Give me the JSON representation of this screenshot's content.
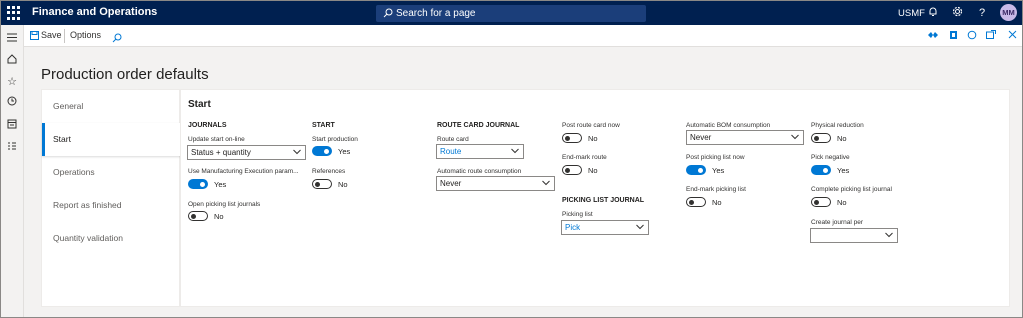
{
  "app": {
    "title": "Finance and Operations",
    "search_placeholder": "Search for a page",
    "company": "USMF",
    "avatar_initials": "MM"
  },
  "actions": {
    "save": "Save",
    "options": "Options"
  },
  "page_title": "Production order defaults",
  "tabs": [
    "General",
    "Start",
    "Operations",
    "Report as finished",
    "Quantity validation"
  ],
  "active_tab": "Start",
  "section_title": "Start",
  "journals": {
    "heading": "JOURNALS",
    "update_start_label": "Update start on-line",
    "update_start_value": "Status + quantity",
    "use_mes_label": "Use Manufacturing Execution param...",
    "use_mes_value": "Yes",
    "open_picking_label": "Open picking list journals",
    "open_picking_value": "No"
  },
  "start": {
    "heading": "START",
    "start_production_label": "Start production",
    "start_production_value": "Yes",
    "references_label": "References",
    "references_value": "No"
  },
  "route_card": {
    "heading": "ROUTE CARD JOURNAL",
    "route_card_label": "Route card",
    "route_card_value": "Route",
    "auto_route_label": "Automatic route consumption",
    "auto_route_value": "Never"
  },
  "col4": {
    "post_route_label": "Post route card now",
    "post_route_value": "No",
    "endmark_route_label": "End-mark route",
    "endmark_route_value": "No",
    "picking_heading": "PICKING LIST JOURNAL",
    "picking_list_label": "Picking list",
    "picking_list_value": "Pick"
  },
  "col5": {
    "auto_bom_label": "Automatic BOM consumption",
    "auto_bom_value": "Never",
    "post_picking_label": "Post picking list now",
    "post_picking_value": "Yes",
    "endmark_picking_label": "End-mark picking list",
    "endmark_picking_value": "No"
  },
  "col6": {
    "physical_reduction_label": "Physical reduction",
    "physical_reduction_value": "No",
    "pick_negative_label": "Pick negative",
    "pick_negative_value": "Yes",
    "complete_picking_label": "Complete picking list journal",
    "complete_picking_value": "No",
    "create_journal_label": "Create journal per",
    "create_journal_value": ""
  },
  "colors": {
    "navbar": "#002050",
    "accent": "#0078d4"
  }
}
